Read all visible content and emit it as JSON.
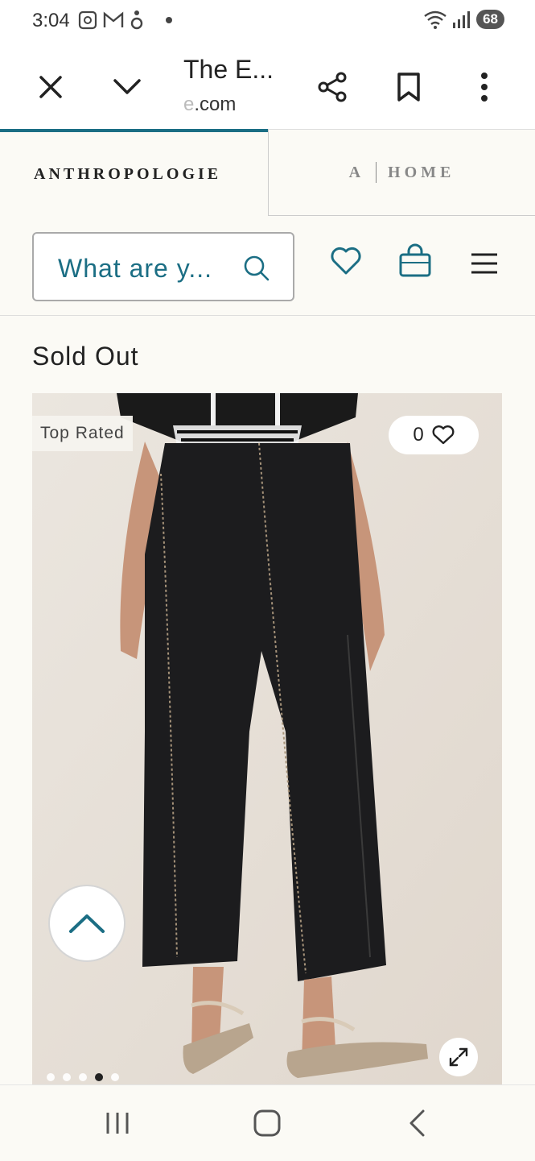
{
  "status_bar": {
    "time": "3:04",
    "battery": "68",
    "left_icons": [
      "screenshot-icon",
      "gmail-icon",
      "accessibility-icon"
    ],
    "right_icons": [
      "wifi-icon",
      "signal-icon"
    ]
  },
  "toolbar": {
    "title": "The E...",
    "url_prefix": "e",
    "url_suffix": ".com",
    "icons": [
      "close-icon",
      "chevron-down-icon",
      "share-icon",
      "bookmark-icon",
      "more-vert-icon"
    ]
  },
  "tabs": {
    "anthropologie": "ANTHROPOLOGIE",
    "home_a": "A",
    "home": "HOME"
  },
  "header": {
    "search_placeholder": "What are y..."
  },
  "product": {
    "status": "Sold Out",
    "badge": "Top Rated",
    "favorites_count": "0",
    "carousel": {
      "count": 5,
      "active_index": 3
    }
  },
  "colors": {
    "accent": "#1b6e84",
    "background": "#fbfaf5"
  }
}
